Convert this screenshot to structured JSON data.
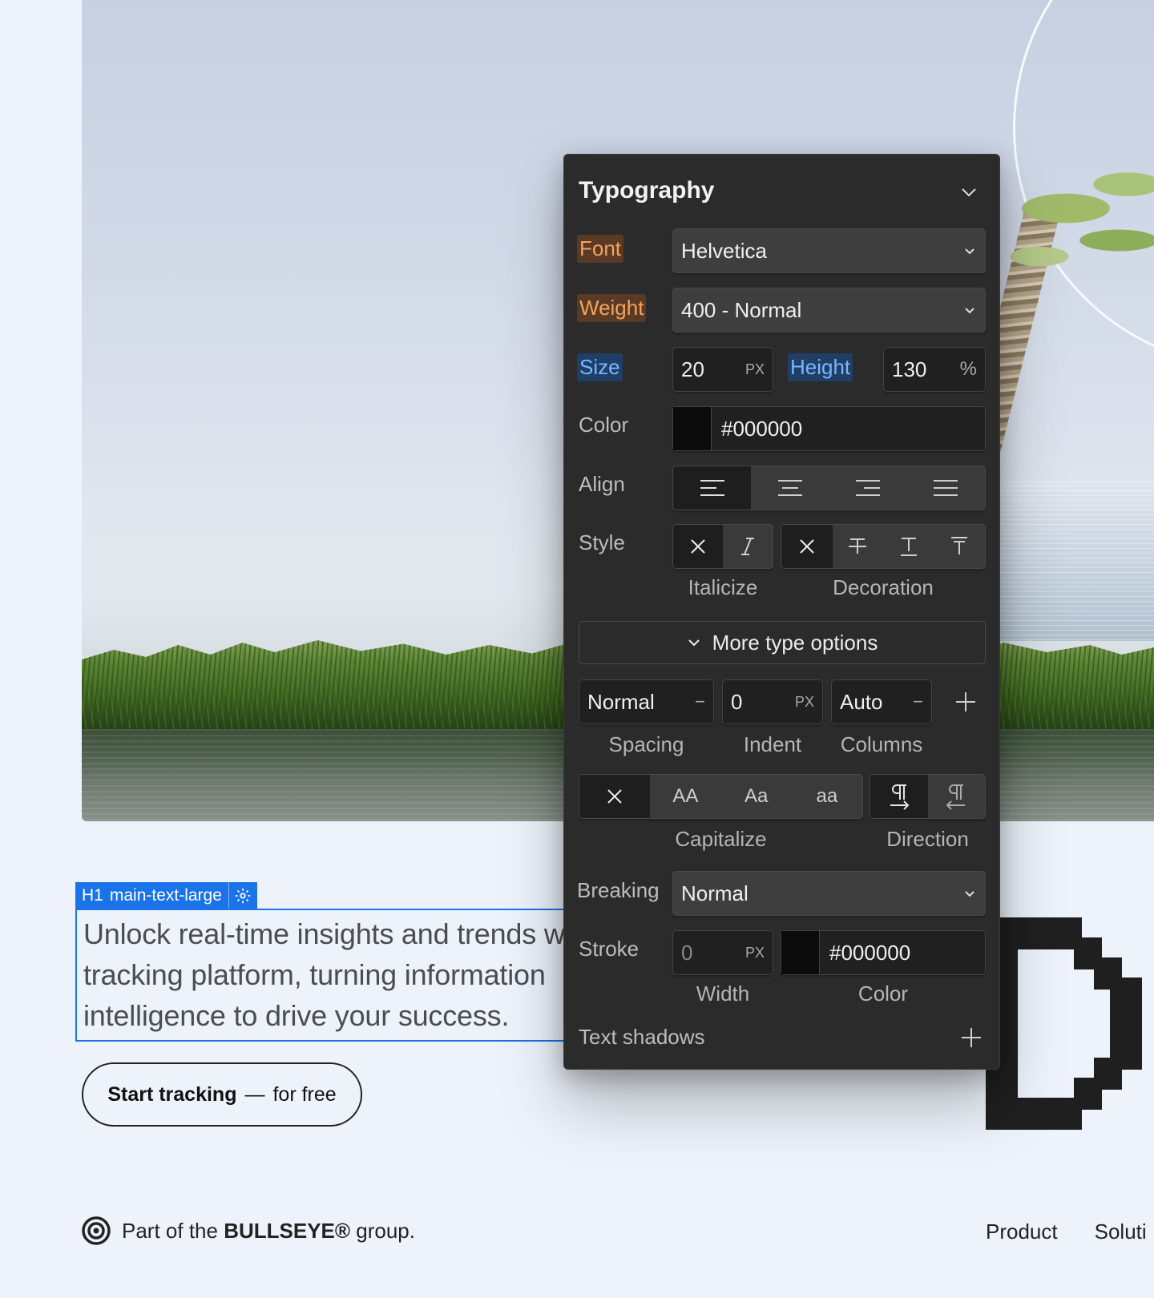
{
  "panel": {
    "title": "Typography",
    "font": {
      "label": "Font",
      "value": "Helvetica"
    },
    "weight": {
      "label": "Weight",
      "value": "400 - Normal"
    },
    "size": {
      "label": "Size",
      "value": "20",
      "unit": "PX"
    },
    "height": {
      "label": "Height",
      "value": "130",
      "unit": "%"
    },
    "color": {
      "label": "Color",
      "value": "#000000"
    },
    "align": {
      "label": "Align",
      "options": [
        "left-align-icon",
        "center-align-icon",
        "right-align-icon",
        "justify-icon"
      ],
      "selected": "left"
    },
    "style": {
      "label": "Style",
      "italicize_caption": "Italicize",
      "decoration_caption": "Decoration"
    },
    "more_options_label": "More type options",
    "spacing": {
      "value": "Normal",
      "dash": "−",
      "caption": "Spacing"
    },
    "indent": {
      "value": "0",
      "unit": "PX",
      "caption": "Indent"
    },
    "columns": {
      "value": "Auto",
      "dash": "−",
      "caption": "Columns"
    },
    "capitalize": {
      "caption": "Capitalize",
      "options": [
        "AA",
        "Aa",
        "aa"
      ]
    },
    "direction": {
      "caption": "Direction"
    },
    "breaking": {
      "label": "Breaking",
      "value": "Normal"
    },
    "stroke": {
      "label": "Stroke",
      "width": "0",
      "unit": "PX",
      "color": "#000000",
      "width_caption": "Width",
      "color_caption": "Color"
    },
    "text_shadows": {
      "label": "Text shadows"
    }
  },
  "selection": {
    "tag": "H1",
    "class_name": "main-text-large"
  },
  "hero": {
    "lines": [
      "Unlock real-time insights and trends w",
      "tracking platform, turning information",
      "intelligence to drive your success."
    ],
    "cta_strong": "Start tracking",
    "cta_dash": "—",
    "cta_light": "for free"
  },
  "footer": {
    "prefix": "Part of the ",
    "brand": "BULLSEYE®",
    "suffix": " group.",
    "nav": [
      "Product",
      "Soluti"
    ]
  },
  "colors": {
    "selection_blue": "#1a73e8",
    "panel_bg": "#2b2b2b",
    "label_orange": "#f4a45a",
    "label_blue": "#7bb5ff"
  }
}
